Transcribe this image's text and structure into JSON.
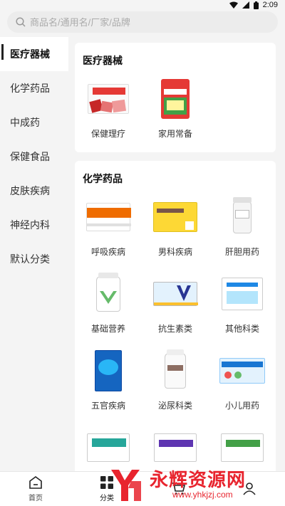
{
  "status": {
    "time": "2:09"
  },
  "search": {
    "placeholder": "商品名/通用名/厂家/品牌"
  },
  "sidebar": {
    "items": [
      {
        "label": "医疗器械",
        "active": true
      },
      {
        "label": "化学药品"
      },
      {
        "label": "中成药"
      },
      {
        "label": "保健食品"
      },
      {
        "label": "皮肤疾病"
      },
      {
        "label": "神经内科"
      },
      {
        "label": "默认分类"
      }
    ]
  },
  "sections": [
    {
      "title": "医疗器械",
      "items": [
        {
          "label": "保健理疗",
          "icon": "pain-patch-box-icon"
        },
        {
          "label": "家用常备",
          "icon": "medical-pack-icon"
        }
      ]
    },
    {
      "title": "化学药品",
      "items": [
        {
          "label": "呼吸疾病",
          "icon": "orange-medicine-box-icon"
        },
        {
          "label": "男科疾病",
          "icon": "yellow-medicine-box-icon"
        },
        {
          "label": "肝胆用药",
          "icon": "white-bottle-icon"
        },
        {
          "label": "基础营养",
          "icon": "vitamin-bottle-icon"
        },
        {
          "label": "抗生素类",
          "icon": "antibiotic-box-icon"
        },
        {
          "label": "其他科类",
          "icon": "granule-box-icon"
        },
        {
          "label": "五官疾病",
          "icon": "blue-box-icon"
        },
        {
          "label": "泌尿科类",
          "icon": "capsule-bottle-icon"
        },
        {
          "label": "小儿用药",
          "icon": "pediatric-box-icon"
        },
        {
          "label": "",
          "icon": "teal-box-icon"
        },
        {
          "label": "",
          "icon": "purple-box-icon"
        },
        {
          "label": "",
          "icon": "green-box-icon"
        }
      ]
    }
  ],
  "tabbar": {
    "items": [
      {
        "label": "首页",
        "icon": "home-icon"
      },
      {
        "label": "分类",
        "icon": "category-icon",
        "active": true
      },
      {
        "label": "",
        "icon": "cart-icon"
      },
      {
        "label": "",
        "icon": "user-icon"
      }
    ]
  },
  "watermark": {
    "text": "永辉资源网",
    "url": "www.yhkjzj.com"
  },
  "colors": {
    "accent": "#e8242e",
    "active_indicator": "#222222"
  }
}
